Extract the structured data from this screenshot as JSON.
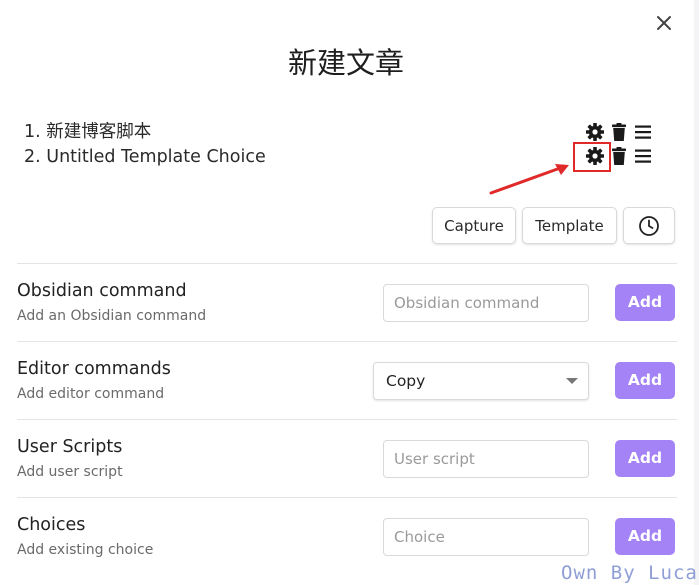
{
  "modal": {
    "title": "新建文章"
  },
  "choices": [
    {
      "label": "1. 新建博客脚本"
    },
    {
      "label": "2. Untitled Template Choice"
    }
  ],
  "choice_buttons": {
    "capture": "Capture",
    "template": "Template"
  },
  "rows": {
    "obsidian": {
      "title": "Obsidian command",
      "description": "Add an Obsidian command",
      "placeholder": "Obsidian command",
      "add_label": "Add"
    },
    "editor": {
      "title": "Editor commands",
      "description": "Add editor command",
      "selected": "Copy",
      "add_label": "Add"
    },
    "user_scripts": {
      "title": "User Scripts",
      "description": "Add user script",
      "placeholder": "User script",
      "add_label": "Add"
    },
    "choices": {
      "title": "Choices",
      "description": "Add existing choice",
      "placeholder": "Choice",
      "add_label": "Add"
    }
  },
  "watermark": "Own By Lucas",
  "colors": {
    "accent": "#a383f5",
    "highlight": "#e02a2a"
  }
}
